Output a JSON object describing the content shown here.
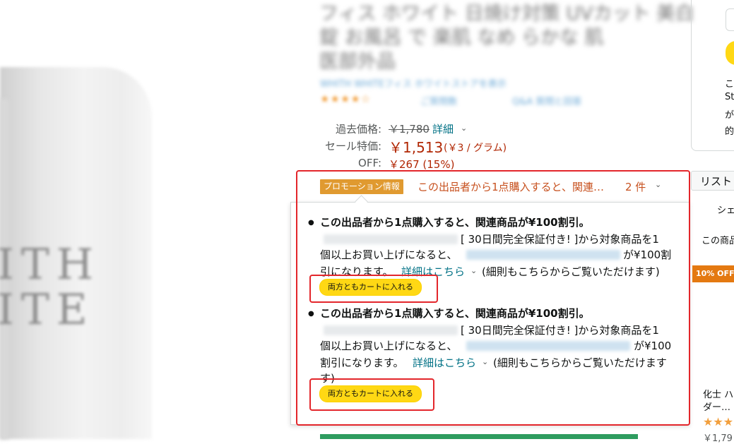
{
  "product": {
    "image_text_line1": "ITH",
    "image_text_line2": "ITE",
    "title_line1": "フィス ホワイト 日焼け対策 UVカット 美白",
    "title_line2": "錠 お風呂 で 楽肌 なめ らかな 肌",
    "title_line3": "医部外品",
    "brand_link": "WHITH WHITEフィス ホワイトストアを表示",
    "ratings_link": "ご質問数",
    "qa_link": "Q&A 質問と回答"
  },
  "pricing": {
    "past_label": "過去価格:",
    "past_price": "￥1,780",
    "past_detail_link": "詳細",
    "sale_label": "セール特価:",
    "sale_price": "￥1,513",
    "unit_price": "(￥3 / グラム)",
    "off_label": "OFF:",
    "off_value": "￥267 (15%)"
  },
  "promotion": {
    "badge": "プロモーション情報",
    "summary": "この出品者から1点購入すると、関連…",
    "count": "2 件",
    "items": [
      {
        "title": "この出品者から1点購入すると、関連商品が¥100割引。",
        "line1_suffix": "[ 30日間完全保証付き! ]から対象商品を1",
        "line2_prefix": "個以上お買い上げになると、",
        "line2_suffix": "が¥100割",
        "line3_prefix": "引になります。",
        "detail_link": "詳細はこちら",
        "line3_suffix": "(細則もこちらからご覧いただけます)",
        "button": "両方ともカートに入れる"
      },
      {
        "title": "この出品者から1点購入すると、関連商品が¥100割引。",
        "line1_suffix": "[ 30日間完全保証付き! ]から対象商品を1",
        "line2_prefix": "個以上お買い上げになると、",
        "line2_suffix": "が¥100",
        "line3_prefix": "割引になります。",
        "detail_link": "詳細はこちら",
        "line3_suffix": "(細則もこちらからご覧いただけます",
        "line4": "す)",
        "button": "両方ともカートに入れる"
      }
    ]
  },
  "right_column": {
    "buybox_text1": "こ",
    "buybox_text2": "St",
    "buybox_text3": "が",
    "buybox_text4": "的",
    "list_button": "リスト",
    "share_text": "シェ",
    "related_text": "この商品",
    "off_badge": "10% OFF",
    "related_title1": "化士 ハ",
    "related_title2": "ダー…",
    "related_stars": "★★★",
    "related_price": "￥1,79"
  },
  "colors": {
    "price_red": "#b12704",
    "link_teal": "#007185",
    "promo_badge": "#e09a30",
    "button_yellow": "#ffd814",
    "annotation_red": "#e3262b"
  }
}
